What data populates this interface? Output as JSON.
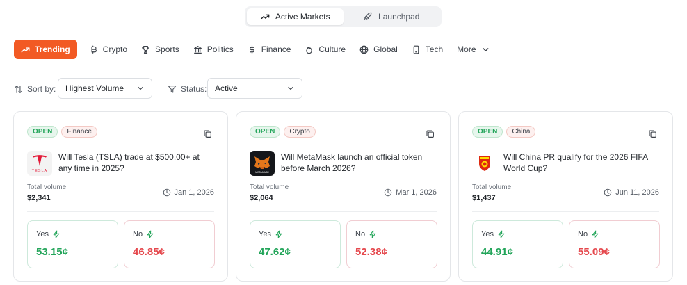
{
  "tabs": [
    {
      "label": "Active Markets",
      "icon": "trending-up-icon",
      "active": true
    },
    {
      "label": "Launchpad",
      "icon": "rocket-icon",
      "active": false
    }
  ],
  "categories": [
    {
      "label": "Trending",
      "icon": "trending-up-icon",
      "active": true
    },
    {
      "label": "Crypto",
      "icon": "bitcoin-icon"
    },
    {
      "label": "Sports",
      "icon": "trophy-icon"
    },
    {
      "label": "Politics",
      "icon": "landmark-icon"
    },
    {
      "label": "Finance",
      "icon": "dollar-icon"
    },
    {
      "label": "Culture",
      "icon": "flame-icon"
    },
    {
      "label": "Global",
      "icon": "globe-icon"
    },
    {
      "label": "Tech",
      "icon": "phone-icon"
    },
    {
      "label": "More",
      "icon": "chevron-down-icon"
    }
  ],
  "filters": {
    "sort_label": "Sort by:",
    "sort_value": "Highest Volume",
    "status_label": "Status:",
    "status_value": "Active"
  },
  "colors": {
    "accent": "#f25a24",
    "yes": "#23a55a",
    "no": "#e5484d"
  },
  "cards": [
    {
      "status": "OPEN",
      "category": "Finance",
      "logo": "tesla-logo",
      "logo_text": "TESLA",
      "question": "Will Tesla (TSLA) trade at $500.00+ at any time in 2025?",
      "volume_label": "Total volume",
      "volume": "$2,341",
      "date": "Jan 1, 2026",
      "yes_label": "Yes",
      "yes_price": "53.15¢",
      "no_label": "No",
      "no_price": "46.85¢"
    },
    {
      "status": "OPEN",
      "category": "Crypto",
      "logo": "metamask-logo",
      "logo_text": "METAMASK",
      "question": "Will MetaMask launch an official token before March 2026?",
      "volume_label": "Total volume",
      "volume": "$2,064",
      "date": "Mar 1, 2026",
      "yes_label": "Yes",
      "yes_price": "47.62¢",
      "no_label": "No",
      "no_price": "52.38¢"
    },
    {
      "status": "OPEN",
      "category": "China",
      "logo": "china-fa-logo",
      "logo_text": "",
      "question": "Will China PR qualify for the 2026 FIFA World Cup?",
      "volume_label": "Total volume",
      "volume": "$1,437",
      "date": "Jun 11, 2026",
      "yes_label": "Yes",
      "yes_price": "44.91¢",
      "no_label": "No",
      "no_price": "55.09¢"
    }
  ]
}
